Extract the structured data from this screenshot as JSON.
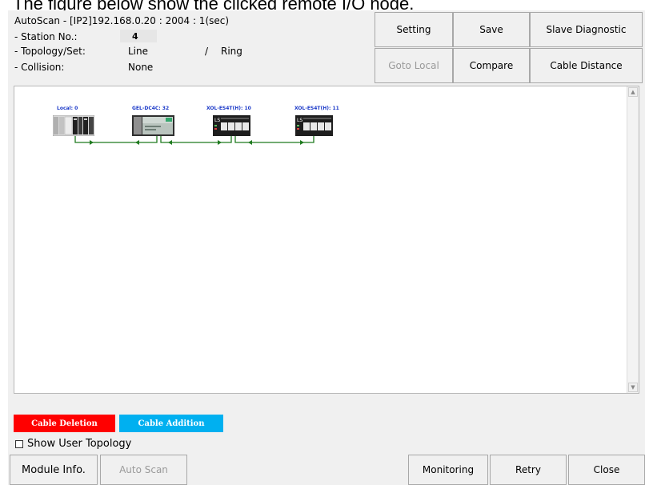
{
  "caption": "The figure below show the clicked remote I/O node.",
  "window": {
    "title": "AutoScan - [IP2]192.168.0.20 : 2004 : 1(sec)",
    "station": {
      "label": "- Station No.:",
      "value": "4"
    },
    "topology": {
      "label": "- Topology/Set:",
      "value": "Line",
      "separator": "/",
      "set_value": "Ring"
    },
    "collision": {
      "label": "- Collision:",
      "value": "None"
    }
  },
  "toolbar": {
    "setting": "Setting",
    "save": "Save",
    "slave_diagnostic": "Slave Diagnostic",
    "goto_local": "Goto Local",
    "compare": "Compare",
    "cable_distance": "Cable Distance"
  },
  "nodes": [
    {
      "label": "Local: 0"
    },
    {
      "label": "GEL-DC4C: 32"
    },
    {
      "label": "XOL-ES4T(H): 10"
    },
    {
      "label": "XOL-ES4T(H): 11"
    }
  ],
  "legend": {
    "deletion": "Cable Deletion",
    "addition": "Cable Addition",
    "deletion_color": "#ff0000",
    "addition_color": "#00b0f0"
  },
  "show_user_topology": {
    "label": "Show User Topology",
    "checked": false
  },
  "bottom": {
    "module_info": "Module Info.",
    "auto_scan": "Auto Scan",
    "monitoring": "Monitoring",
    "retry": "Retry",
    "close": "Close"
  },
  "colors": {
    "link": "#1f7a1f",
    "label": "#1b39c8"
  }
}
